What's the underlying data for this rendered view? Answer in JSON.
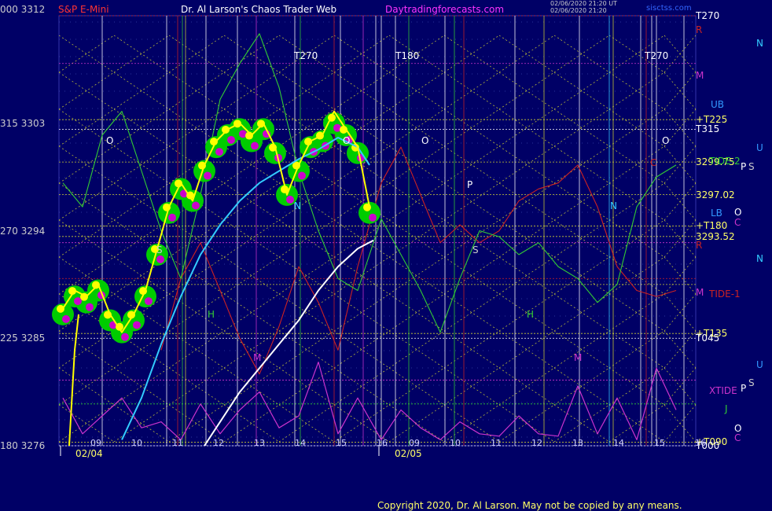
{
  "header": {
    "left_label": "000  3312",
    "instrument": "S&P E-Mini",
    "site_title": "Dr. Al Larson's Chaos Trader Web",
    "site_url": "Daytradingforecasts.com",
    "timestamp_1": "02/06/2020 21:20 UT",
    "timestamp_2": "02/06/2020 21:20",
    "corner_tag": "sisctss.com"
  },
  "copyright": "Copyright 2020, Dr. Al Larson. May not be copied by any means.",
  "colors": {
    "background": "#000066",
    "price": "#ffff00",
    "band": "#00cc00",
    "band_dots": "#cc00cc",
    "cyan_avg": "#33ccff",
    "white_avg": "#ffffff",
    "green_line": "#33cc33",
    "red_line": "#cc2222",
    "xtide": "#cc33cc"
  },
  "left_axis": [
    {
      "label": "315  3303",
      "value": 3303
    },
    {
      "label": "270  3294",
      "value": 3294
    },
    {
      "label": "225  3285",
      "value": 3285
    },
    {
      "label": "180  3276",
      "value": 3276
    }
  ],
  "right_levels": [
    {
      "label": "T270",
      "value": 3312,
      "color": "#ffffff"
    },
    {
      "label": "T315",
      "value": 3302.5,
      "color": "#ffffff"
    },
    {
      "label": "+T225",
      "value": 3303.3,
      "color": "#ffff66"
    },
    {
      "label": "3299.75",
      "value": 3299.75,
      "color": "#ffff66"
    },
    {
      "label": "3297.02",
      "value": 3297.02,
      "color": "#ffff66"
    },
    {
      "label": "+T180",
      "value": 3294.4,
      "color": "#ffff66"
    },
    {
      "label": "3293.52",
      "value": 3293.52,
      "color": "#ffff66"
    },
    {
      "label": "+T135",
      "value": 3285.4,
      "color": "#ffff66"
    },
    {
      "label": "T045",
      "value": 3285.0,
      "color": "#ffffff"
    },
    {
      "label": "+T090",
      "value": 3276.3,
      "color": "#ffff66"
    },
    {
      "label": "T000",
      "value": 3276.0,
      "color": "#ffffff"
    }
  ],
  "right_markers": [
    {
      "label": "R",
      "color": "#cc2222",
      "row": 38
    },
    {
      "label": "N",
      "color": "#33ccff",
      "row": 55
    },
    {
      "label": "M",
      "color": "#cc33cc",
      "row": 96
    },
    {
      "label": "UB",
      "color": "#3399ff",
      "row": 133
    },
    {
      "label": "U",
      "color": "#3399ff",
      "row": 188
    },
    {
      "label": "TIDE-2",
      "color": "#33cc33",
      "row": 205
    },
    {
      "label": "S",
      "color": "#cccccc",
      "row": 212
    },
    {
      "label": "P",
      "color": "#ffffff",
      "row": 212
    },
    {
      "label": "LB",
      "color": "#3399ff",
      "row": 271
    },
    {
      "label": "O",
      "color": "#ffffff",
      "row": 270
    },
    {
      "label": "C",
      "color": "#cc33cc",
      "row": 283
    },
    {
      "label": "R",
      "color": "#cc2222",
      "row": 312
    },
    {
      "label": "N",
      "color": "#33ccff",
      "row": 329
    },
    {
      "label": "M",
      "color": "#cc33cc",
      "row": 372
    },
    {
      "label": "TIDE-1",
      "color": "#cc2222",
      "row": 374
    },
    {
      "label": "U",
      "color": "#3399ff",
      "row": 464
    },
    {
      "label": "XTIDE",
      "color": "#cc33cc",
      "row": 497
    },
    {
      "label": "P",
      "color": "#ffffff",
      "row": 494
    },
    {
      "label": "S",
      "color": "#cccccc",
      "row": 487
    },
    {
      "label": "J",
      "color": "#33cc33",
      "row": 520
    },
    {
      "label": "O",
      "color": "#ffffff",
      "row": 545
    },
    {
      "label": "C",
      "color": "#cc33cc",
      "row": 557
    }
  ],
  "dates": [
    {
      "label": "02/04",
      "x_index": 0
    },
    {
      "label": "02/05",
      "x_index": 1
    }
  ],
  "top_tags": [
    {
      "label": "T270",
      "day": 1,
      "color": "#ffffff"
    },
    {
      "label": "T180",
      "day": 2,
      "color": "#ffffff"
    },
    {
      "label": "T270",
      "day": 3,
      "color": "#ffffff"
    }
  ],
  "hour_ticks": {
    "day1": [
      "09",
      "10",
      "11",
      "12",
      "13",
      "14",
      "15",
      "16"
    ],
    "day2": [
      "09",
      "10",
      "11",
      "12",
      "13",
      "14",
      "15",
      "16"
    ]
  },
  "chart_data": {
    "type": "line",
    "title": "S&P E-Mini",
    "xlabel": "",
    "ylabel": "",
    "ylim": [
      3276,
      3312
    ],
    "x_unit": "hours (Feb 4 09:00 to Feb 5 16:00)",
    "series": [
      {
        "name": "price",
        "x": [
          0,
          0.3,
          0.6,
          0.9,
          1.2,
          1.5,
          1.8,
          2.1,
          2.4,
          2.7,
          3.0,
          3.3,
          3.6,
          3.9,
          4.2,
          4.5,
          4.8,
          5.1,
          5.4,
          5.7,
          6.0,
          6.3,
          6.6,
          6.9,
          7.2,
          7.5,
          7.8
        ],
        "values": [
          3287.5,
          3289.0,
          3288.5,
          3289.5,
          3287.0,
          3285.5,
          3287.0,
          3289.0,
          3292.5,
          3296.0,
          3298.0,
          3296.5,
          3299.5,
          3301.5,
          3302.5,
          3303.0,
          3302.0,
          3303.0,
          3301.0,
          3297.0,
          3299.5,
          3301.5,
          3302.0,
          3304.0,
          3302.5,
          3301.0,
          3296.0
        ]
      },
      {
        "name": "band",
        "x": [
          0,
          0.3,
          0.6,
          0.9,
          1.2,
          1.5,
          1.8,
          2.1,
          2.4,
          2.7,
          3.0,
          3.3,
          3.6,
          3.9,
          4.2,
          4.5,
          4.8,
          5.1,
          5.4,
          5.7,
          6.0,
          6.3,
          6.6,
          6.9,
          7.2,
          7.5,
          7.8
        ],
        "values": [
          3287.0,
          3288.5,
          3288.0,
          3289.0,
          3286.5,
          3285.5,
          3286.5,
          3288.5,
          3292.0,
          3295.5,
          3297.5,
          3296.5,
          3299.0,
          3301.0,
          3302.0,
          3302.5,
          3301.5,
          3302.5,
          3300.5,
          3297.0,
          3299.0,
          3301.0,
          3301.5,
          3303.0,
          3302.0,
          3300.5,
          3295.5
        ]
      },
      {
        "name": "cyan average",
        "x": [
          1.5,
          2.0,
          2.5,
          3.0,
          3.5,
          4.0,
          4.5,
          5.0,
          5.5,
          6.0,
          6.5,
          7.0,
          7.5,
          7.8
        ],
        "values": [
          3276.5,
          3280.0,
          3284.5,
          3288.5,
          3292.0,
          3294.5,
          3296.5,
          3298.0,
          3299.0,
          3300.0,
          3300.8,
          3301.8,
          3301.0,
          3299.5
        ]
      },
      {
        "name": "white average",
        "x": [
          3.6,
          4.0,
          4.5,
          5.0,
          5.5,
          6.0,
          6.5,
          7.0,
          7.5,
          7.9
        ],
        "values": [
          3276.0,
          3278.0,
          3280.5,
          3282.5,
          3284.5,
          3286.5,
          3289.0,
          3291.0,
          3292.5,
          3293.2
        ]
      },
      {
        "name": "TIDE-2",
        "x": [
          0,
          0.5,
          1.0,
          1.5,
          2.0,
          2.5,
          3.0,
          3.5,
          4.0,
          4.5,
          5.0,
          5.5,
          6.0,
          6.5,
          7.0,
          7.5,
          8.0,
          8.5,
          9.0,
          9.5,
          10.0,
          10.5,
          11.0,
          11.5,
          12.0,
          12.5,
          13.0,
          13.5,
          14.0,
          14.5,
          15.0,
          15.5
        ],
        "values": [
          3298.0,
          3296.0,
          3302.0,
          3304.0,
          3299.0,
          3294.0,
          3290.0,
          3297.0,
          3305.0,
          3308.0,
          3310.5,
          3306.0,
          3299.0,
          3294.0,
          3290.0,
          3289.0,
          3295.0,
          3292.0,
          3289.0,
          3285.5,
          3290.0,
          3294.0,
          3293.5,
          3292.0,
          3293.0,
          3291.0,
          3290.0,
          3288.0,
          3289.5,
          3296.0,
          3298.5,
          3299.5
        ]
      },
      {
        "name": "TIDE-1",
        "x": [
          2.5,
          3.0,
          3.5,
          4.0,
          4.5,
          5.0,
          5.5,
          6.0,
          6.5,
          7.0,
          7.5,
          8.0,
          8.5,
          9.0,
          9.5,
          10.0,
          10.5,
          11.0,
          11.5,
          12.0,
          12.5,
          13.0,
          13.5,
          14.0,
          14.5,
          15.0,
          15.5
        ],
        "values": [
          3284.0,
          3290.0,
          3293.0,
          3289.0,
          3285.0,
          3282.0,
          3286.0,
          3291.0,
          3288.0,
          3284.0,
          3291.0,
          3298.0,
          3301.0,
          3297.0,
          3293.0,
          3294.5,
          3293.0,
          3294.0,
          3296.5,
          3297.5,
          3298.0,
          3299.5,
          3296.0,
          3291.0,
          3289.0,
          3288.5,
          3289.0
        ]
      },
      {
        "name": "XTIDE",
        "x": [
          0,
          0.5,
          1.0,
          1.5,
          2.0,
          2.5,
          3.0,
          3.5,
          4.0,
          4.5,
          5.0,
          5.5,
          6.0,
          6.5,
          7.0,
          7.5,
          8.0,
          8.5,
          9.0,
          9.5,
          10.0,
          10.5,
          11.0,
          11.5,
          12.0,
          12.5,
          13.0,
          13.5,
          14.0,
          14.5,
          15.0,
          15.5
        ],
        "values": [
          3280.0,
          3277.0,
          3278.5,
          3280.0,
          3277.5,
          3278.0,
          3276.5,
          3279.5,
          3277.0,
          3279.0,
          3280.5,
          3277.5,
          3278.5,
          3283.0,
          3277.0,
          3280.0,
          3276.5,
          3279.0,
          3277.5,
          3276.5,
          3278.0,
          3277.0,
          3276.8,
          3278.5,
          3277.0,
          3276.8,
          3281.0,
          3277.0,
          3280.0,
          3276.5,
          3282.5,
          3279.0
        ]
      }
    ]
  }
}
